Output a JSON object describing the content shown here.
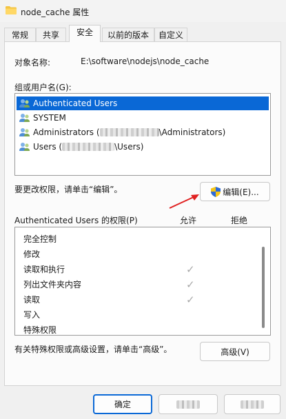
{
  "window": {
    "title": "node_cache 属性"
  },
  "tabs": [
    {
      "label": "常规"
    },
    {
      "label": "共享"
    },
    {
      "label": "安全"
    },
    {
      "label": "以前的版本"
    },
    {
      "label": "自定义"
    }
  ],
  "object": {
    "label": "对象名称:",
    "value": "E:\\software\\nodejs\\node_cache"
  },
  "groups": {
    "label": "组或用户名(G):",
    "items": [
      {
        "prefix": "Authenticated Users",
        "suffix": ""
      },
      {
        "prefix": "SYSTEM",
        "suffix": ""
      },
      {
        "prefix": "Administrators (",
        "suffix": "\\Administrators)"
      },
      {
        "prefix": "Users (",
        "suffix": "\\Users)"
      }
    ],
    "selected_index": 0
  },
  "edit": {
    "hint": "要更改权限，请单击“编辑”。",
    "button_label": "编辑(E)..."
  },
  "permissions": {
    "label": "Authenticated Users 的权限(P)",
    "allow_header": "允许",
    "deny_header": "拒绝",
    "items": [
      {
        "name": "完全控制",
        "allow": false
      },
      {
        "name": "修改",
        "allow": false
      },
      {
        "name": "读取和执行",
        "allow": true
      },
      {
        "name": "列出文件夹内容",
        "allow": true
      },
      {
        "name": "读取",
        "allow": true
      },
      {
        "name": "写入",
        "allow": false
      },
      {
        "name": "特殊权限",
        "allow": false
      }
    ],
    "check_glyph": "✓"
  },
  "advanced": {
    "hint": "有关特殊权限或高级设置，请单击“高级”。",
    "button_label": "高级(V)"
  },
  "footer": {
    "ok_label": "确定"
  },
  "colors": {
    "selection": "#0a68d6",
    "accent": "#0a68d6"
  }
}
